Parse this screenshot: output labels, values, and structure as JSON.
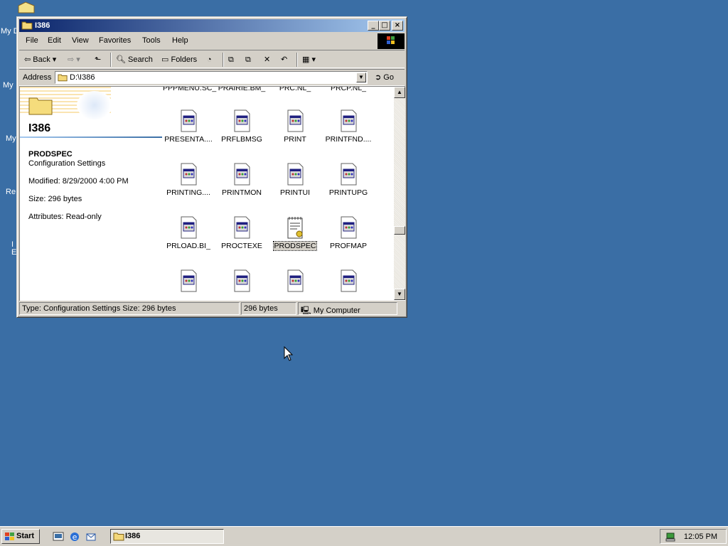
{
  "desktop": {
    "icons": [
      "My D",
      "My",
      "My",
      "Re",
      "I\nE"
    ]
  },
  "window": {
    "title": "I386",
    "controls": {
      "minimize": "_",
      "maximize": "□",
      "close": "×"
    },
    "menu": [
      "File",
      "Edit",
      "View",
      "Favorites",
      "Tools",
      "Help"
    ],
    "toolbar": {
      "back": "Back",
      "search": "Search",
      "folders": "Folders"
    },
    "address": {
      "label": "Address",
      "value": "D:\\I386",
      "go": "Go"
    }
  },
  "details": {
    "folder_name": "I386",
    "selected_name": "PRODSPEC",
    "selected_type": "Configuration Settings",
    "modified": "Modified: 8/29/2000 4:00 PM",
    "size": "Size: 296 bytes",
    "attributes": "Attributes: Read-only"
  },
  "files": [
    {
      "name": "PPPMENU.SC_",
      "row": 0,
      "col": 0
    },
    {
      "name": "PRAIRIE.BM_",
      "row": 0,
      "col": 1
    },
    {
      "name": "PRC.NL_",
      "row": 0,
      "col": 2
    },
    {
      "name": "PRCP.NL_",
      "row": 0,
      "col": 3
    },
    {
      "name": "PRESENTA....",
      "row": 1,
      "col": 0
    },
    {
      "name": "PRFLBMSG",
      "row": 1,
      "col": 1
    },
    {
      "name": "PRINT",
      "row": 1,
      "col": 2
    },
    {
      "name": "PRINTFND....",
      "row": 1,
      "col": 3
    },
    {
      "name": "PRINTING....",
      "row": 2,
      "col": 0
    },
    {
      "name": "PRINTMON",
      "row": 2,
      "col": 1
    },
    {
      "name": "PRINTUI",
      "row": 2,
      "col": 2
    },
    {
      "name": "PRINTUPG",
      "row": 2,
      "col": 3
    },
    {
      "name": "PRLOAD.BI_",
      "row": 3,
      "col": 0
    },
    {
      "name": "PROCTEXE",
      "row": 3,
      "col": 1
    },
    {
      "name": "PRODSPEC",
      "row": 3,
      "col": 2,
      "selected": true,
      "kind": "config"
    },
    {
      "name": "PROFMAP",
      "row": 3,
      "col": 3
    }
  ],
  "statusbar": {
    "info": "Type: Configuration Settings Size: 296 bytes",
    "size": "296 bytes",
    "zone": "My Computer"
  },
  "taskbar": {
    "start": "Start",
    "task": "I386",
    "clock": "12:05 PM"
  }
}
